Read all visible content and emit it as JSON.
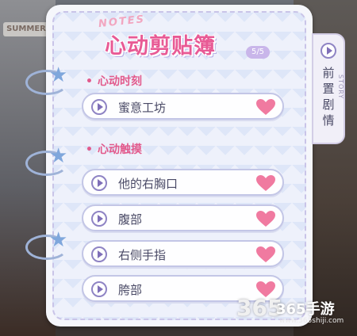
{
  "background": {
    "sign_text": "SUMMER"
  },
  "notebook": {
    "notes_label": "NOTES",
    "title": "心动剪贴簿",
    "count": "5/5"
  },
  "sections": [
    {
      "label": "心动时刻",
      "items": [
        {
          "label": "蜜意工坊"
        }
      ]
    },
    {
      "label": "心动触摸",
      "items": [
        {
          "label": "他的右胸口"
        },
        {
          "label": "腹部"
        },
        {
          "label": "右侧手指"
        },
        {
          "label": "胯部"
        }
      ]
    }
  ],
  "story_tab": {
    "label": "前置剧情",
    "english": "STORY"
  },
  "watermark": {
    "logo": "365",
    "text": "365手游",
    "url": "www.365shiji.com"
  },
  "colors": {
    "accent_pink": "#e85a95",
    "heart": "#f07aa0",
    "play_purple": "#7f6fb8"
  }
}
